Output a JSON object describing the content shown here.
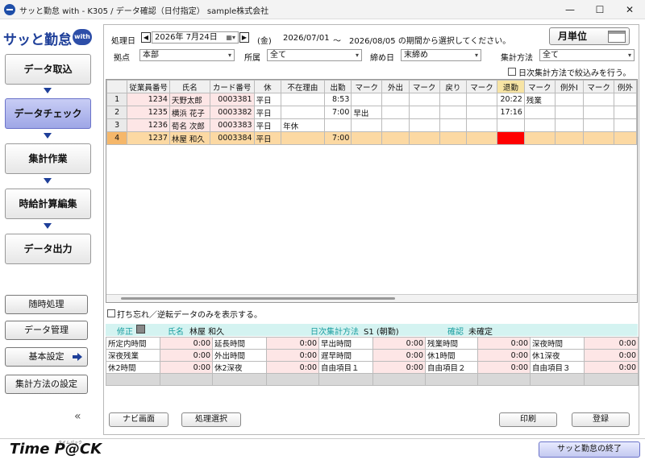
{
  "window": {
    "title": "サッと勤怠 with - K305 / データ確認（日付指定）   sample株式会社",
    "minimize": "—",
    "maximize": "☐",
    "close": "✕"
  },
  "logo": {
    "text": "サッと勤怠",
    "badge": "with"
  },
  "nav": {
    "items": [
      "データ取込",
      "データチェック",
      "集計作業",
      "時給計算編集",
      "データ出力"
    ],
    "active_index": 1
  },
  "side_buttons": [
    "随時処理",
    "データ管理",
    "基本設定",
    "集計方法の設定"
  ],
  "collapse": "«",
  "filters": {
    "process_date_label": "処理日",
    "process_date": "2026年 7月24日",
    "weekday": "(金)",
    "range_from": "2026/07/01",
    "range_sep": "～",
    "range_to_text": "2026/08/05 の期間から選択してください。",
    "site_label": "拠点",
    "site_value": "本部",
    "dept_label": "所属",
    "dept_value": "全て",
    "closing_label": "締め日",
    "closing_value": "末締め",
    "method_label": "集計方法",
    "method_value": "全て",
    "month_button": "月単位",
    "daily_filter_label": "日次集計方法で絞込みを行う。"
  },
  "grid": {
    "columns": [
      "",
      "従業員番号",
      "氏名",
      "カード番号",
      "休",
      "不在理由",
      "出勤",
      "マーク",
      "外出",
      "マーク",
      "戻り",
      "マーク",
      "退勤",
      "マーク",
      "例外Ⅰ",
      "マーク",
      "例外"
    ],
    "rows": [
      {
        "no": "1",
        "emp": "1234",
        "name": "天野太郎",
        "card": "0003381",
        "kyu": "平日",
        "reason": "",
        "in": "8:53",
        "in_mark": "",
        "out_time": "",
        "out_mark": "",
        "back": "",
        "back_mark": "",
        "leave": "20:22",
        "leave_mark": "残業"
      },
      {
        "no": "2",
        "emp": "1235",
        "name": "横浜 花子",
        "card": "0003382",
        "kyu": "平日",
        "reason": "",
        "in": "7:00",
        "in_mark": "早出",
        "out_time": "",
        "out_mark": "",
        "back": "",
        "back_mark": "",
        "leave": "17:16",
        "leave_mark": ""
      },
      {
        "no": "3",
        "emp": "1236",
        "name": "荀名 次郎",
        "card": "0003383",
        "kyu": "平日",
        "reason": "年休",
        "in": "",
        "in_mark": "",
        "out_time": "",
        "out_mark": "",
        "back": "",
        "back_mark": "",
        "leave": "",
        "leave_mark": ""
      },
      {
        "no": "4",
        "emp": "1237",
        "name": "林屋 和久",
        "card": "0003384",
        "kyu": "平日",
        "reason": "",
        "in": "7:00",
        "in_mark": "",
        "out_time": "",
        "out_mark": "",
        "back": "",
        "back_mark": "",
        "leave": "",
        "leave_mark": ""
      }
    ],
    "selected_row": 3
  },
  "reverse_only_label": "打ち忘れ／逆転データのみを表示する。",
  "detail": {
    "fix_label": "修正",
    "name_label": "氏名",
    "name_value": "林屋 和久",
    "daily_method_label": "日次集計方法",
    "daily_method_value": "S1 (朝勤)",
    "confirm_label": "確認",
    "confirm_value": "未確定",
    "rows": [
      [
        [
          "所定内時間",
          "0:00"
        ],
        [
          "延長時間",
          "0:00"
        ],
        [
          "早出時間",
          "0:00"
        ],
        [
          "残業時間",
          "0:00"
        ],
        [
          "深夜時間",
          "0:00"
        ]
      ],
      [
        [
          "深夜残業",
          "0:00"
        ],
        [
          "外出時間",
          "0:00"
        ],
        [
          "遅早時間",
          "0:00"
        ],
        [
          "休1時間",
          "0:00"
        ],
        [
          "休1深夜",
          "0:00"
        ]
      ],
      [
        [
          "休2時間",
          "0:00"
        ],
        [
          "休2深夜",
          "0:00"
        ],
        [
          "自由項目１",
          "0:00"
        ],
        [
          "自由項目２",
          "0:00"
        ],
        [
          "自由項目３",
          "0:00"
        ]
      ]
    ]
  },
  "bottom_buttons": {
    "navi": "ナビ画面",
    "process": "処理選択",
    "print": "印刷",
    "register": "登録"
  },
  "footer": {
    "brand": "Time P@CK",
    "brand_sub": "タイムパック",
    "exit": "サッと勤怠の終了"
  }
}
